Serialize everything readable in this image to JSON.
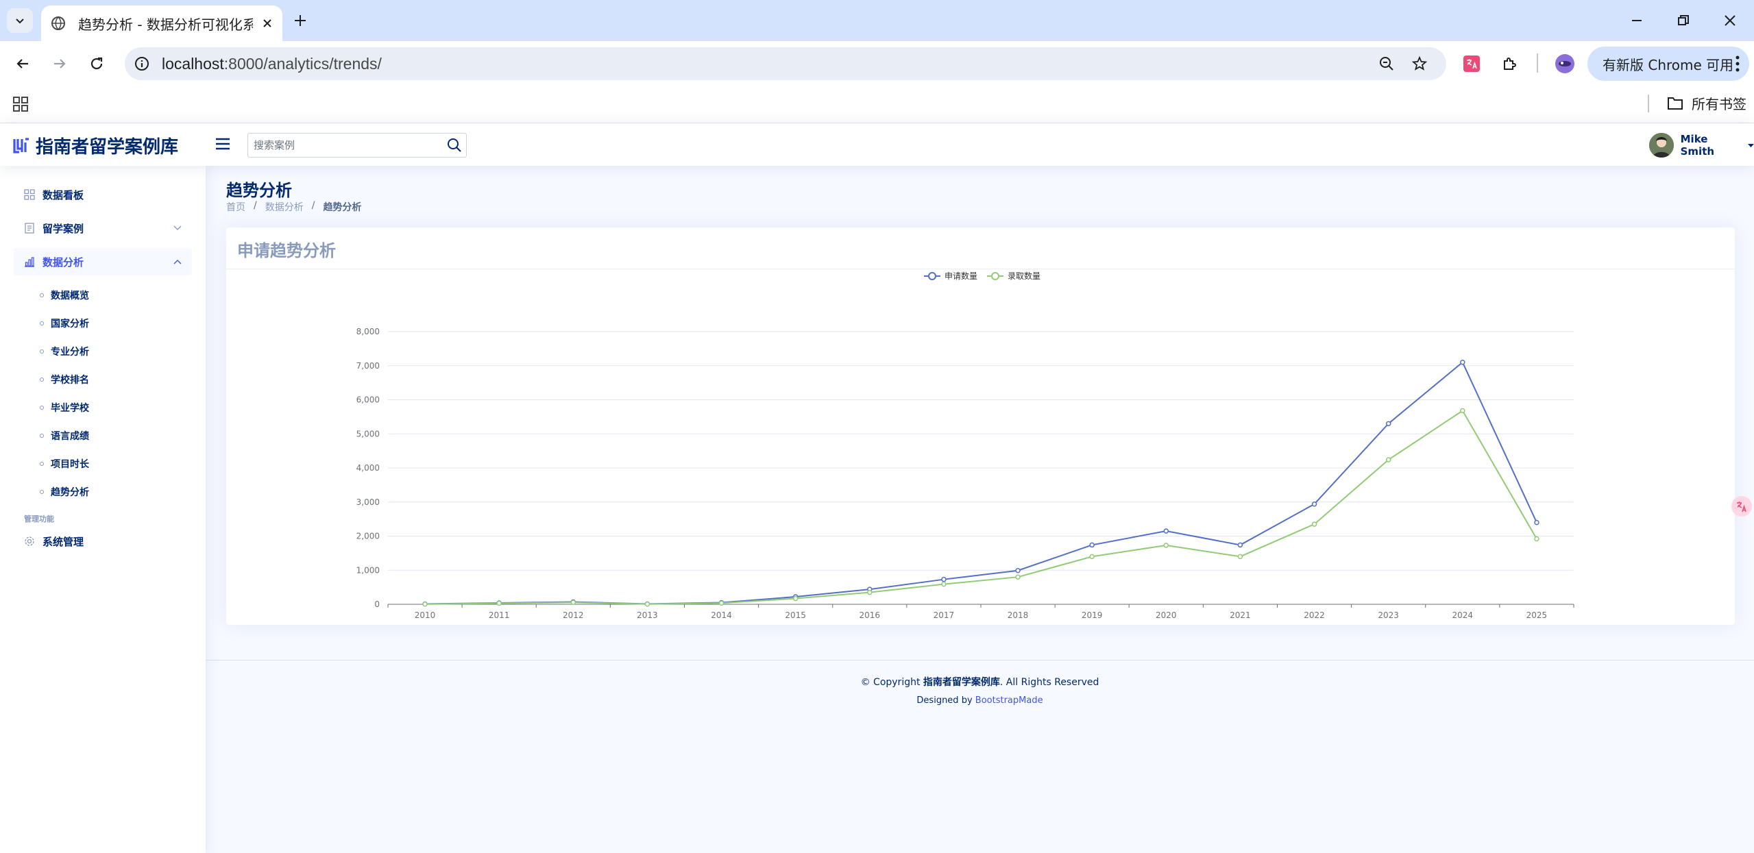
{
  "browser": {
    "tab_title": "趋势分析 - 数据分析可视化系统",
    "url_host": "localhost",
    "url_path": ":8000/analytics/trends/",
    "update_label": "有新版 Chrome 可用",
    "bookmarks_all": "所有书签"
  },
  "header": {
    "logo_text": "指南者留学案例库",
    "search_placeholder": "搜索案例",
    "user_name": "Mike Smith"
  },
  "sidebar": {
    "items": [
      {
        "label": "数据看板"
      },
      {
        "label": "留学案例"
      },
      {
        "label": "数据分析"
      }
    ],
    "sub_items": [
      "数据概览",
      "国家分析",
      "专业分析",
      "学校排名",
      "毕业学校",
      "语言成绩",
      "项目时长",
      "趋势分析"
    ],
    "heading": "管理功能",
    "admin_label": "系统管理"
  },
  "main": {
    "page_title": "趋势分析",
    "breadcrumb": [
      "首页",
      "数据分析",
      "趋势分析"
    ],
    "separator": "/",
    "card_title": "申请趋势分析"
  },
  "chart_data": {
    "type": "line",
    "x": [
      "2010",
      "2011",
      "2012",
      "2013",
      "2014",
      "2015",
      "2016",
      "2017",
      "2018",
      "2019",
      "2020",
      "2021",
      "2022",
      "2023",
      "2024",
      "2025"
    ],
    "series": [
      {
        "name": "申请数量",
        "color": "#5470c6",
        "values": [
          10,
          40,
          70,
          10,
          50,
          220,
          440,
          730,
          990,
          1740,
          2150,
          1740,
          2940,
          5300,
          7100,
          2400
        ]
      },
      {
        "name": "录取数量",
        "color": "#91cc75",
        "values": [
          5,
          30,
          55,
          5,
          35,
          170,
          350,
          590,
          800,
          1400,
          1730,
          1400,
          2350,
          4240,
          5680,
          1920
        ]
      }
    ],
    "ylim": [
      0,
      8000
    ],
    "yticks": [
      "0",
      "1,000",
      "2,000",
      "3,000",
      "4,000",
      "5,000",
      "6,000",
      "7,000",
      "8,000"
    ],
    "legend": "top-center",
    "grid": true
  },
  "footer": {
    "copyright_prefix": "© Copyright ",
    "brand": "指南者留学案例库",
    "copyright_suffix": ". All Rights Reserved",
    "designed_by": "Designed by ",
    "designer": "BootstrapMade"
  }
}
